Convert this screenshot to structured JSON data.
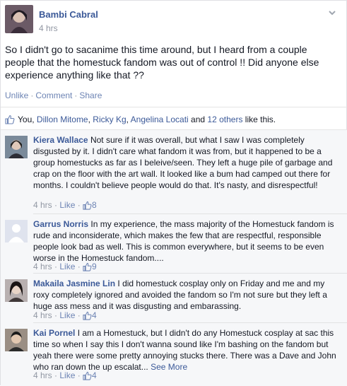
{
  "post": {
    "author": "Bambi Cabral",
    "time": "4 hrs",
    "text": "So I didn't go to sacanime this time around, but I heard from a couple people that the homestuck fandom was out of control !! Did anyone else experience anything like that ??",
    "actions": [
      "Unlike",
      "Comment",
      "Share"
    ],
    "likes": {
      "you": "You, ",
      "names": [
        "Dillon Mitome",
        "Ricky Kg",
        "Angelina Locati"
      ],
      "and": " and ",
      "others": "12 others",
      "suffix": " like this."
    }
  },
  "comments": [
    {
      "author": "Kiera Wallace",
      "text": "Not sure if it was overall, but what I saw I was completely disgusted by it. I didn't care what fandom it was from, but it happened to be a group homestucks as far as I beleive/seen. They left a huge pile of garbage and crap on the floor with the art wall. It looked like a bum had camped out there for months. I couldn't believe people would do that. It's nasty, and disrespectful!",
      "time": "4 hrs",
      "like": "Like",
      "count": "8",
      "more": ""
    },
    {
      "author": "Garrus Norris",
      "text": "In my experience, the mass majority of the Homestuck fandom is rude and inconsiderate, which makes the few that are respectful, responsible people look bad as well. This is common everywhere, but it seems to be even worse in the Homestuck fandom....",
      "time": "4 hrs",
      "like": "Like",
      "count": "9",
      "more": ""
    },
    {
      "author": "Makaila Jasmine Lin",
      "text": "I did homestuck cosplay only on Friday and me and my roxy completely ignored and avoided the fandom so I'm not sure but they left a huge ass mess and it was disgusting and embarassing.",
      "time": "4 hrs",
      "like": "Like",
      "count": "4",
      "more": ""
    },
    {
      "author": "Kai Pornel",
      "text": "I am a Homestuck, but I didn't do any Homestuck cosplay at sac this time so when I say this I don't wanna sound like I'm bashing on the fandom but yeah there were some pretty annoying stucks there. There was a Dave and John who ran down the up escalat...",
      "time": "4 hrs",
      "like": "Like",
      "count": "4",
      "more": "See More"
    }
  ],
  "colors": {
    "link": "#3b5998",
    "action": "#6d84b4",
    "muted": "#9197a3",
    "comment_bg": "#f6f7f9"
  }
}
